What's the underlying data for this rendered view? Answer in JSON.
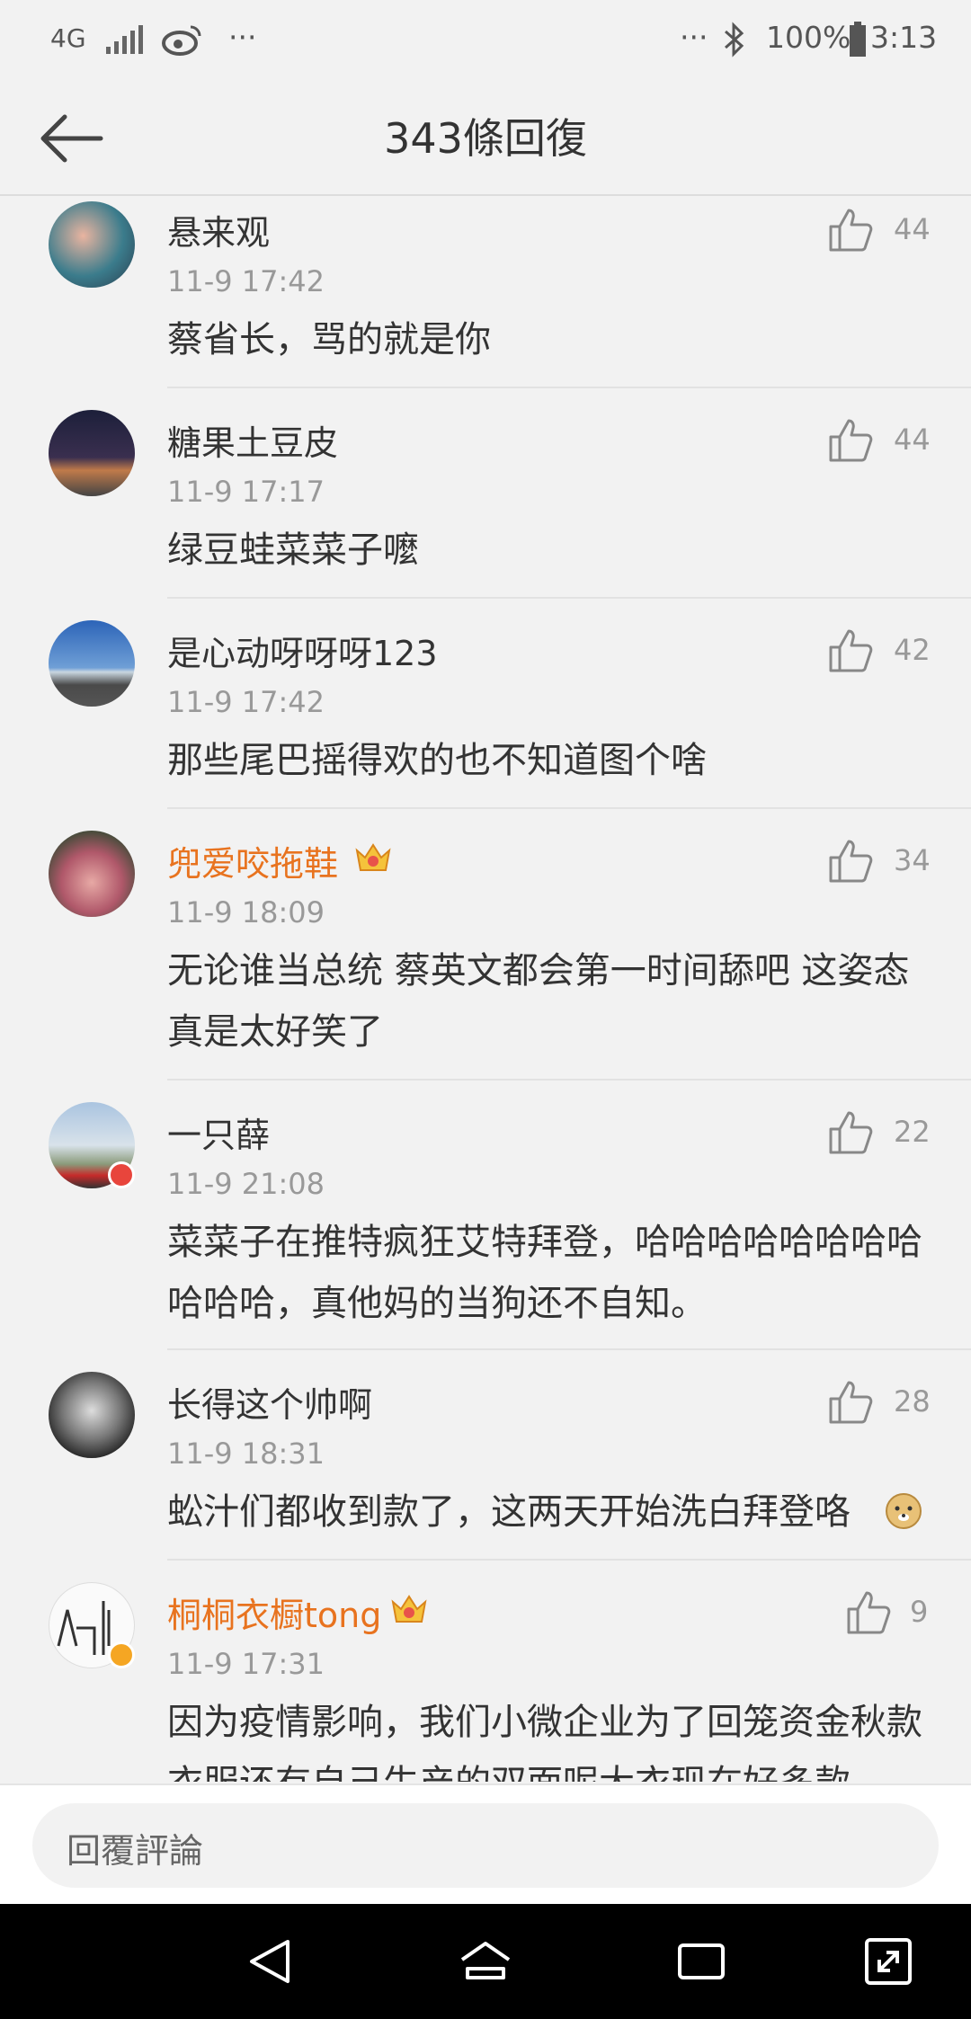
{
  "status_bar": {
    "network": "4G",
    "signal_icon": "signal-bars-icon",
    "app_icon": "weibo-icon",
    "more": "···",
    "right_more": "···",
    "bluetooth_icon": "bluetooth-icon",
    "battery": "100%",
    "time": "3:13"
  },
  "header": {
    "back_icon": "arrow-left-icon",
    "title": "343條回復"
  },
  "comments": [
    {
      "name": "悬来观",
      "vip": false,
      "time": "11-9 17:42",
      "text": "蔡省长，骂的就是你",
      "likes": "44"
    },
    {
      "name": "糖果土豆皮",
      "vip": false,
      "time": "11-9 17:17",
      "text": "绿豆蛙菜菜子嚒",
      "likes": "44"
    },
    {
      "name": "是心动呀呀呀123",
      "vip": false,
      "time": "11-9 17:42",
      "text": "那些尾巴摇得欢的也不知道图个啥",
      "likes": "42"
    },
    {
      "name": "兜爱咬拖鞋",
      "vip": true,
      "time": "11-9 18:09",
      "text": "无论谁当总统 蔡英文都会第一时间舔吧 这姿态真是太好笑了",
      "likes": "34"
    },
    {
      "name": "一只薛",
      "vip": false,
      "time": "11-9 21:08",
      "text": "菜菜子在推特疯狂艾特拜登，哈哈哈哈哈哈哈哈哈哈哈，真他妈的当狗还不自知。",
      "likes": "22"
    },
    {
      "name": "长得这个帅啊",
      "vip": false,
      "time": "11-9 18:31",
      "text": "蚣汁们都收到款了，这两天开始洗白拜登咯",
      "likes": "28"
    },
    {
      "name": "桐桐衣橱tong",
      "vip": true,
      "time": "11-9 17:31",
      "text": "因为疫情影响，我们小微企业为了回笼资金秋款衣服还有自己生产的双面呢大衣现在好多款",
      "likes": "9"
    }
  ],
  "reply_bar": {
    "placeholder": "回覆評論"
  },
  "nav": {
    "back_icon": "triangle-back-icon",
    "home_icon": "home-icon",
    "recents_icon": "recents-icon",
    "expand_icon": "expand-icon"
  },
  "colors": {
    "vip_name": "#e8731f",
    "bg": "#f2f2f2",
    "accent_badge": "#f5a623"
  }
}
